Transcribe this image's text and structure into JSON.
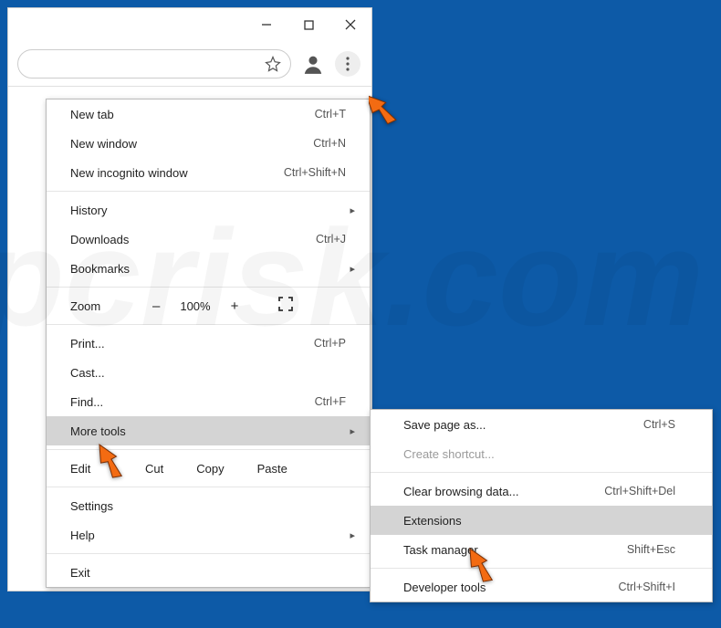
{
  "titlebar": {
    "min": "—",
    "max": "▢",
    "close": "✕"
  },
  "toolbar": {
    "star": "☆",
    "profile": "person",
    "kebab": "⋮"
  },
  "menu": {
    "newtab": {
      "label": "New tab",
      "accel": "Ctrl+T"
    },
    "newwin": {
      "label": "New window",
      "accel": "Ctrl+N"
    },
    "incog": {
      "label": "New incognito window",
      "accel": "Ctrl+Shift+N"
    },
    "history": {
      "label": "History"
    },
    "downloads": {
      "label": "Downloads",
      "accel": "Ctrl+J"
    },
    "bookmarks": {
      "label": "Bookmarks"
    },
    "zoom": {
      "label": "Zoom",
      "minus": "–",
      "pct": "100%",
      "plus": "+",
      "full": "⛶"
    },
    "print": {
      "label": "Print...",
      "accel": "Ctrl+P"
    },
    "cast": {
      "label": "Cast..."
    },
    "find": {
      "label": "Find...",
      "accel": "Ctrl+F"
    },
    "moretools": {
      "label": "More tools"
    },
    "edit": {
      "label": "Edit",
      "cut": "Cut",
      "copy": "Copy",
      "paste": "Paste"
    },
    "settings": {
      "label": "Settings"
    },
    "help": {
      "label": "Help"
    },
    "exit": {
      "label": "Exit"
    }
  },
  "submenu": {
    "savepage": {
      "label": "Save page as...",
      "accel": "Ctrl+S"
    },
    "shortcut": {
      "label": "Create shortcut..."
    },
    "clear": {
      "label": "Clear browsing data...",
      "accel": "Ctrl+Shift+Del"
    },
    "ext": {
      "label": "Extensions"
    },
    "taskmgr": {
      "label": "Task manager",
      "accel": "Shift+Esc"
    },
    "devtools": {
      "label": "Developer tools",
      "accel": "Ctrl+Shift+I"
    }
  },
  "watermark": "pcrisk.com"
}
